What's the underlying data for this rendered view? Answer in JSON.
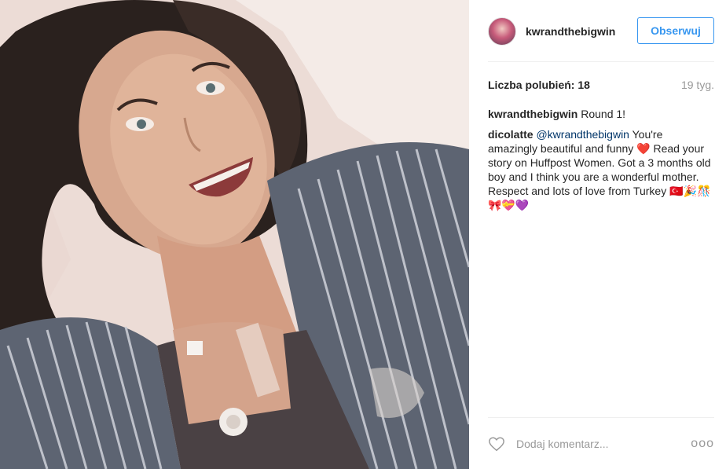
{
  "post": {
    "image_alt": "selfie in hospital bed",
    "username": "kwrandthebigwin",
    "follow_label": "Obserwuj",
    "likes": "Liczba polubień: 18",
    "time_ago": "19 tyg."
  },
  "comments": [
    {
      "user": "kwrandthebigwin",
      "mention": "",
      "text": "Round 1!"
    },
    {
      "user": "dicolatte",
      "mention": "@kwrandthebigwin",
      "text": "You're amazingly beautiful and funny",
      "heart": "❤️",
      "text2": "Read your story on Huffpost Women. Got a 3 months old boy and I think you are a wonderful mother. Respect and lots of love from Turkey",
      "emojis": "🇹🇷🎉🎊🎀💝💜"
    }
  ],
  "footer": {
    "comment_placeholder": "Dodaj komentarz...",
    "more_label": "ooo"
  },
  "icons": {
    "heart": "heart-outline-icon",
    "more": "more-options-icon"
  },
  "colors": {
    "accent": "#3897f0",
    "mention": "#003569",
    "muted": "#999999",
    "text": "#262626",
    "divider": "#efefef"
  }
}
